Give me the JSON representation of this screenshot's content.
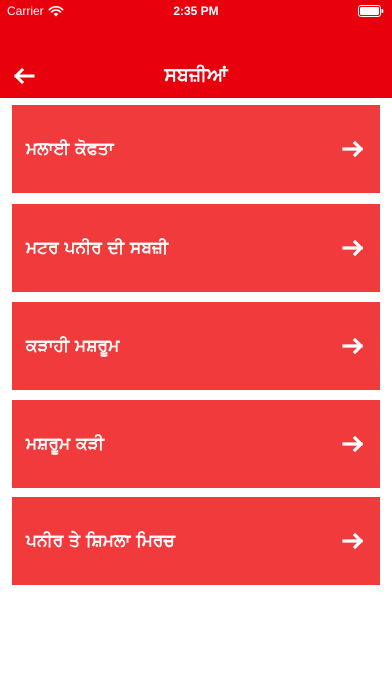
{
  "status_bar": {
    "carrier": "Carrier",
    "time": "2:35 PM",
    "wifi_icon": "wifi-icon",
    "battery_icon": "battery-icon"
  },
  "header": {
    "background_color": "#e8000c",
    "back_icon": "back-arrow-icon",
    "title": "ਸਬਜ਼ੀਆਂ"
  },
  "list": {
    "item_color": "#f13a3c",
    "items": [
      {
        "label": "ਮਲਾਈ ਕੋਫਤਾ",
        "icon": "right-arrow-icon"
      },
      {
        "label": "ਮਟਰ ਪਨੀਰ ਦੀ ਸਬਜ਼ੀ",
        "icon": "right-arrow-icon"
      },
      {
        "label": "ਕੜਾਹੀ ਮਸ਼ਰੂਮ",
        "icon": "right-arrow-icon"
      },
      {
        "label": "ਮਸ਼ਰੂਮ ਕੜੀ",
        "icon": "right-arrow-icon"
      },
      {
        "label": "ਪਨੀਰ ਤੇ ਸ਼ਿਮਲਾ ਮਿਰਚ",
        "icon": "right-arrow-icon"
      }
    ]
  }
}
